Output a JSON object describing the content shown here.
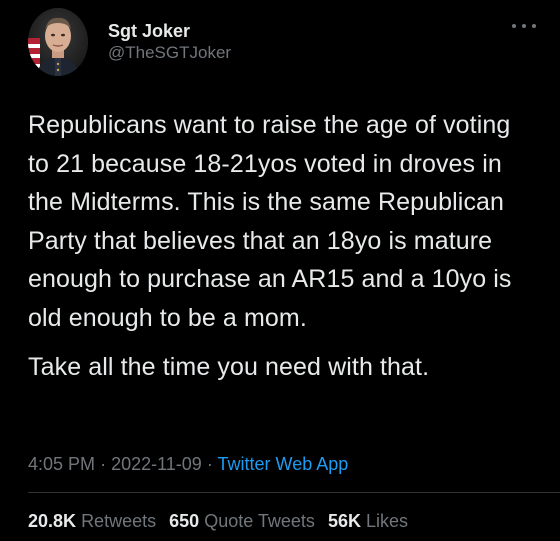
{
  "user": {
    "display_name": "Sgt Joker",
    "handle": "@TheSGTJoker"
  },
  "tweet": {
    "paragraphs": [
      "Republicans want to raise the age of voting to 21 because 18-21yos voted in droves in the Midterms. This is the same Republican Party that believes that an 18yo is mature enough to purchase an AR15 and a 10yo is old enough to be a mom.",
      "Take all the time you need with that."
    ],
    "time": "4:05 PM",
    "date": "2022-11-09",
    "separator": "·",
    "source": "Twitter Web App"
  },
  "stats": {
    "retweets_count": "20.8K",
    "retweets_label": "Retweets",
    "quotes_count": "650",
    "quotes_label": "Quote Tweets",
    "likes_count": "56K",
    "likes_label": "Likes"
  },
  "icons": {
    "more": "more-horizontal-icon",
    "avatar": "profile-avatar"
  },
  "colors": {
    "background": "#000000",
    "text": "#e7e9ea",
    "secondary": "#71767b",
    "link": "#1d9bf0"
  }
}
